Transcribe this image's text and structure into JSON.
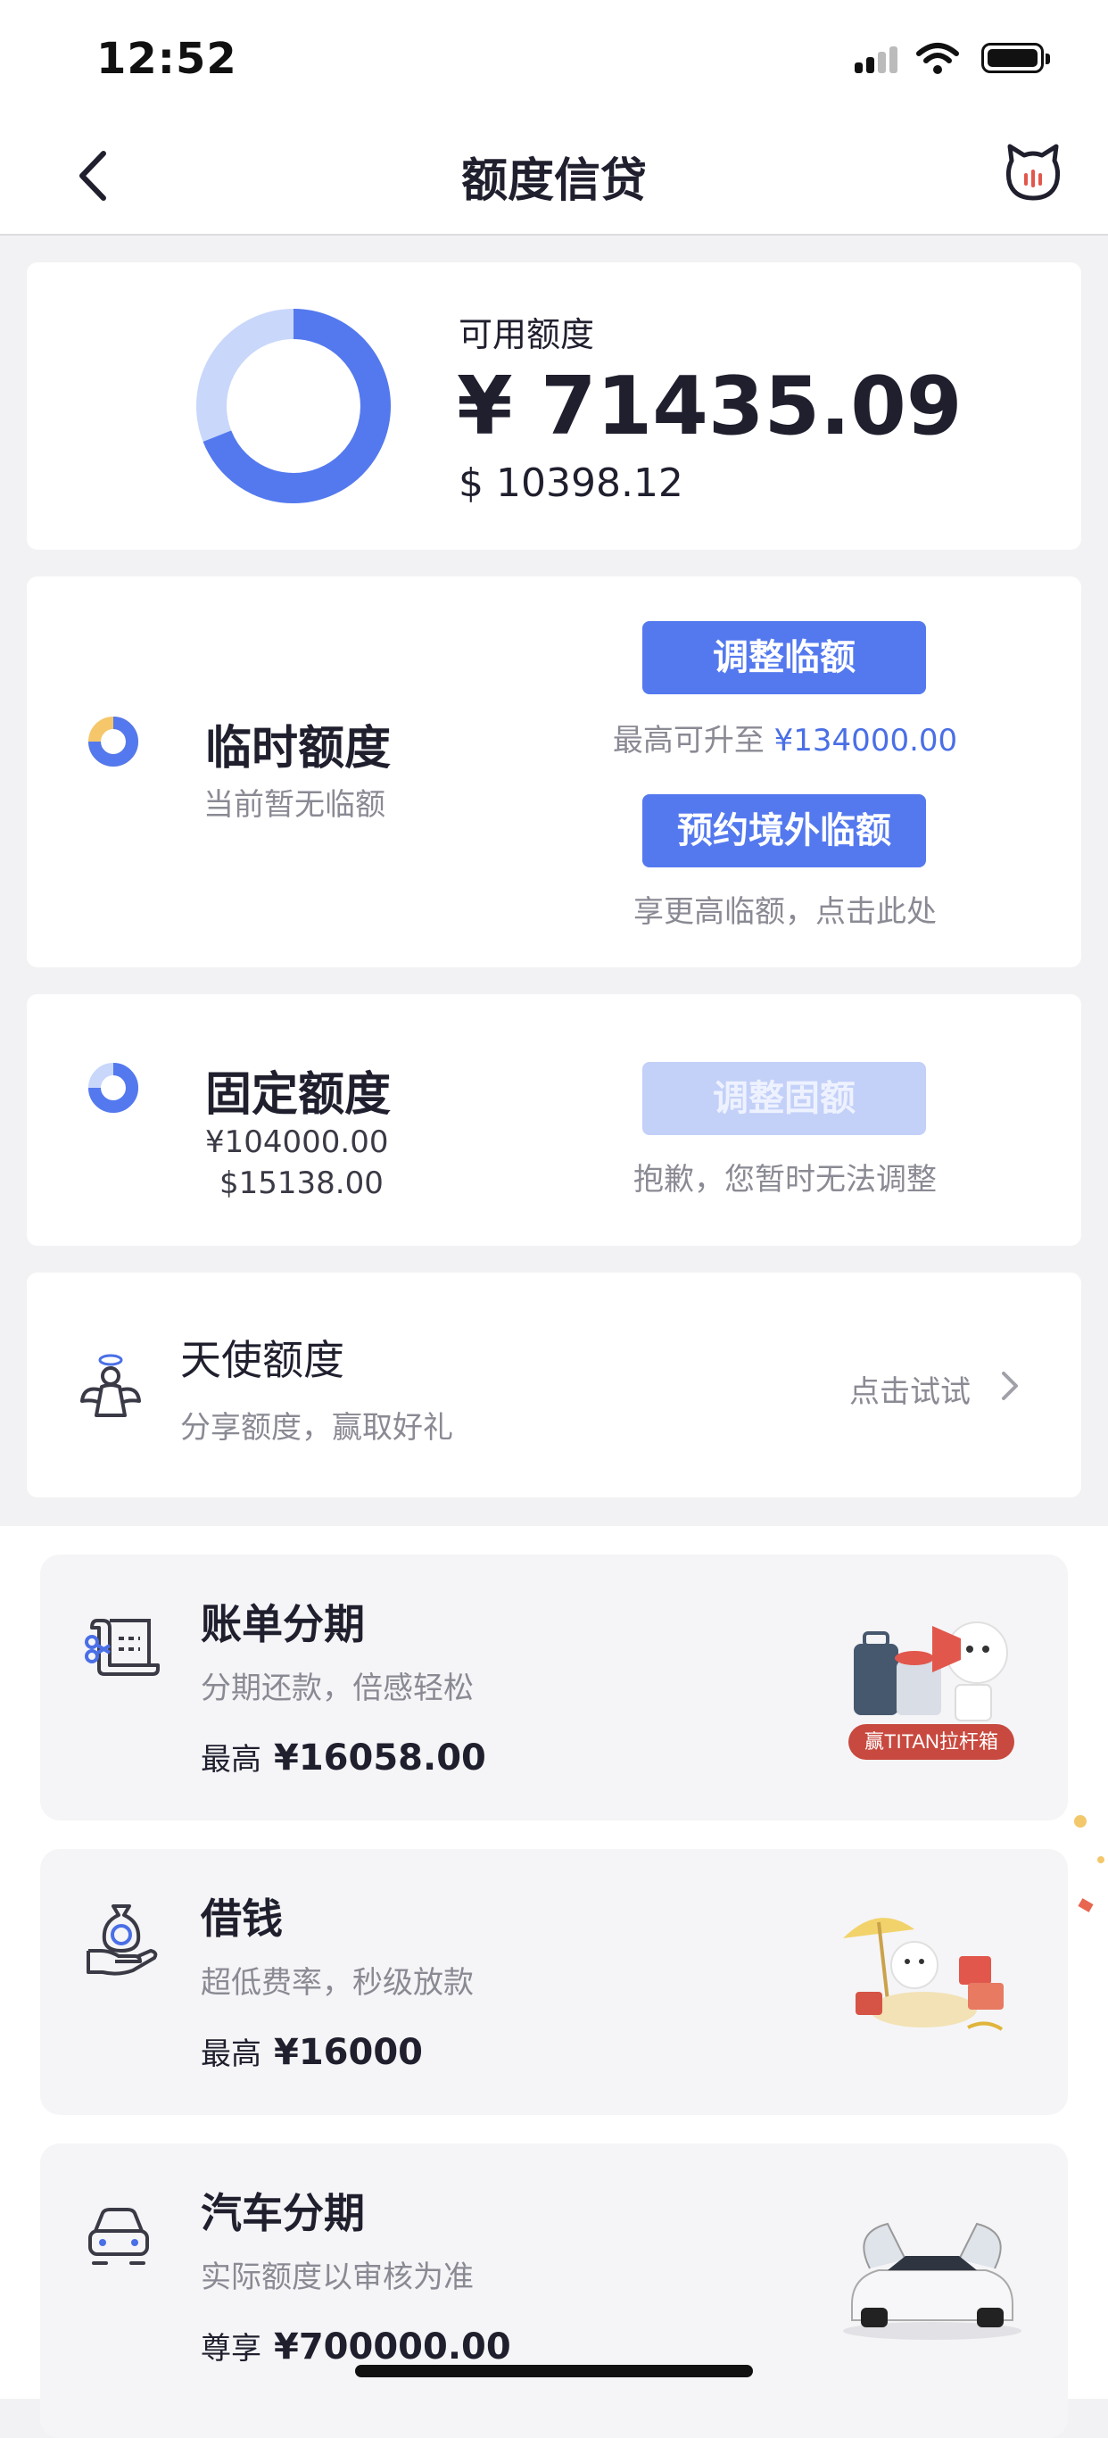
{
  "status_bar": {
    "time": "12:52"
  },
  "nav": {
    "title": "额度信贷"
  },
  "available": {
    "label": "可用额度",
    "amount_cny": "¥ 71435.09",
    "amount_usd": "$ 10398.12",
    "used_fraction": 0.31
  },
  "temporary": {
    "title": "临时额度",
    "subtitle": "当前暂无临额",
    "adjust_button": "调整临额",
    "max_prefix": "最高可升至",
    "max_value": "¥134000.00",
    "overseas_button": "预约境外临额",
    "overseas_hint": "享更高临额，点击此处"
  },
  "fixed": {
    "title": "固定额度",
    "amount_cny": "¥104000.00",
    "amount_usd": "$15138.00",
    "adjust_button": "调整固额",
    "hint": "抱歉，您暂时无法调整"
  },
  "angel": {
    "title": "天使额度",
    "subtitle": "分享额度，赢取好礼",
    "action": "点击试试"
  },
  "products": [
    {
      "title": "账单分期",
      "desc": "分期还款，倍感轻松",
      "prefix": "最高",
      "amount": "¥16058.00",
      "badge": "赢TITAN拉杆箱"
    },
    {
      "title": "借钱",
      "desc": "超低费率，秒级放款",
      "prefix": "最高",
      "amount": "¥16000"
    },
    {
      "title": "汽车分期",
      "desc": "实际额度以审核为准",
      "prefix": "尊享",
      "amount": "¥700000.00"
    }
  ],
  "colors": {
    "accent": "#5479ee",
    "accent_light": "#c3d0f8",
    "card_bg": "#f5f5f7"
  }
}
